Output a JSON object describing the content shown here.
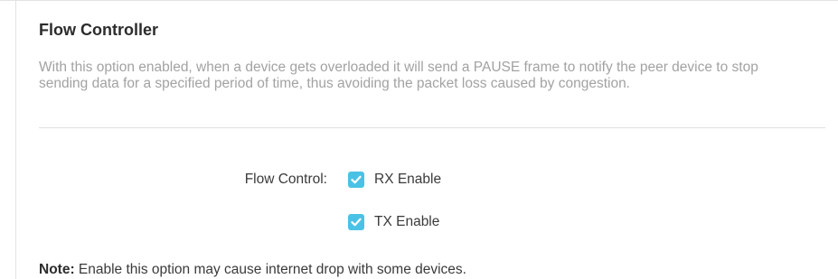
{
  "section": {
    "title": "Flow Controller",
    "description": "With this option enabled, when a device gets overloaded it will send a PAUSE frame to notify the peer device to stop sending data for a specified period of time, thus avoiding the packet loss caused by congestion."
  },
  "flow_control": {
    "label": "Flow Control:",
    "options": [
      {
        "label": "RX Enable",
        "checked": true
      },
      {
        "label": "TX Enable",
        "checked": true
      }
    ]
  },
  "note": {
    "prefix": "Note:",
    "text": " Enable this option may cause internet drop with some devices."
  },
  "colors": {
    "checkbox_accent": "#4bc2e5",
    "title_text": "#2c2c2c",
    "description_text": "#a2a2a2"
  },
  "icons": {
    "checkbox": "checkmark-icon"
  }
}
